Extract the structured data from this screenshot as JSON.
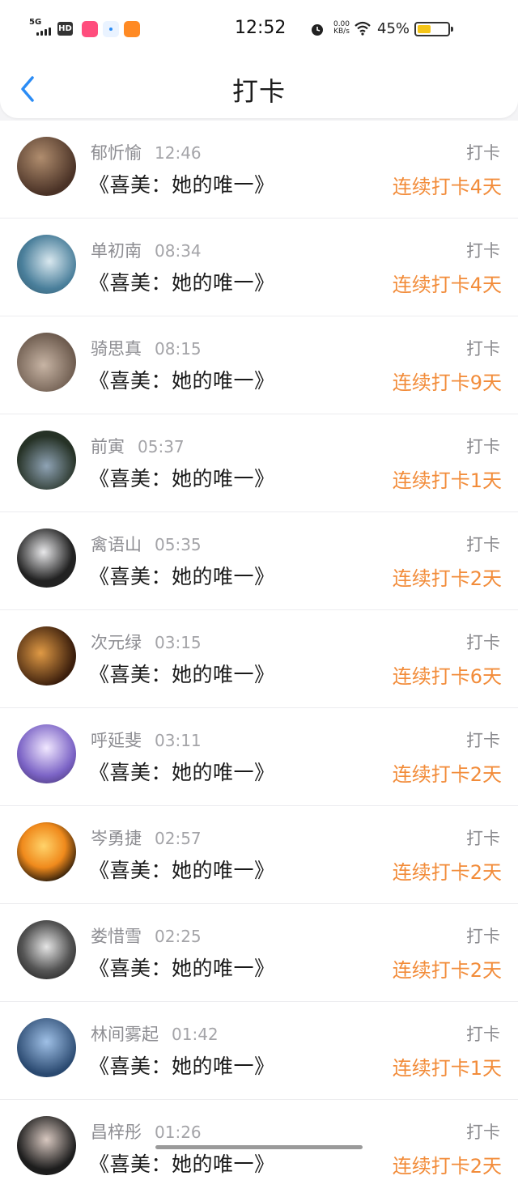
{
  "status_bar": {
    "network": "5G",
    "hd": "HD",
    "time": "12:52",
    "net_speed_value": "0.00",
    "net_speed_unit": "KB/s",
    "battery_percent": "45%",
    "battery_level": 0.45,
    "app_icons": [
      "lola-icon",
      "compass-icon",
      "app-icon"
    ]
  },
  "header": {
    "title": "打卡",
    "back_icon": "chevron-left-icon",
    "accent_color": "#2b8cf5"
  },
  "entries": [
    {
      "name": "郁忻愉",
      "time": "12:46",
      "book": "《喜美：她的唯一》",
      "label": "打卡",
      "streak": "连续打卡4天"
    },
    {
      "name": "单初南",
      "time": "08:34",
      "book": "《喜美：她的唯一》",
      "label": "打卡",
      "streak": "连续打卡4天"
    },
    {
      "name": "骑思真",
      "time": "08:15",
      "book": "《喜美：她的唯一》",
      "label": "打卡",
      "streak": "连续打卡9天"
    },
    {
      "name": "前寅",
      "time": "05:37",
      "book": "《喜美：她的唯一》",
      "label": "打卡",
      "streak": "连续打卡1天"
    },
    {
      "name": "禽语山",
      "time": "05:35",
      "book": "《喜美：她的唯一》",
      "label": "打卡",
      "streak": "连续打卡2天"
    },
    {
      "name": "次元绿",
      "time": "03:15",
      "book": "《喜美：她的唯一》",
      "label": "打卡",
      "streak": "连续打卡6天"
    },
    {
      "name": "呼延斐",
      "time": "03:11",
      "book": "《喜美：她的唯一》",
      "label": "打卡",
      "streak": "连续打卡2天"
    },
    {
      "name": "岑勇捷",
      "time": "02:57",
      "book": "《喜美：她的唯一》",
      "label": "打卡",
      "streak": "连续打卡2天"
    },
    {
      "name": "娄惜雪",
      "time": "02:25",
      "book": "《喜美：她的唯一》",
      "label": "打卡",
      "streak": "连续打卡2天"
    },
    {
      "name": "林间雾起",
      "time": "01:42",
      "book": "《喜美：她的唯一》",
      "label": "打卡",
      "streak": "连续打卡1天"
    },
    {
      "name": "昌梓彤",
      "time": "01:26",
      "book": "《喜美：她的唯一》",
      "label": "打卡",
      "streak": "连续打卡2天"
    }
  ],
  "colors": {
    "streak": "#f28c3a",
    "meta_text": "#8d8d92",
    "background": "#f4f4f6"
  }
}
